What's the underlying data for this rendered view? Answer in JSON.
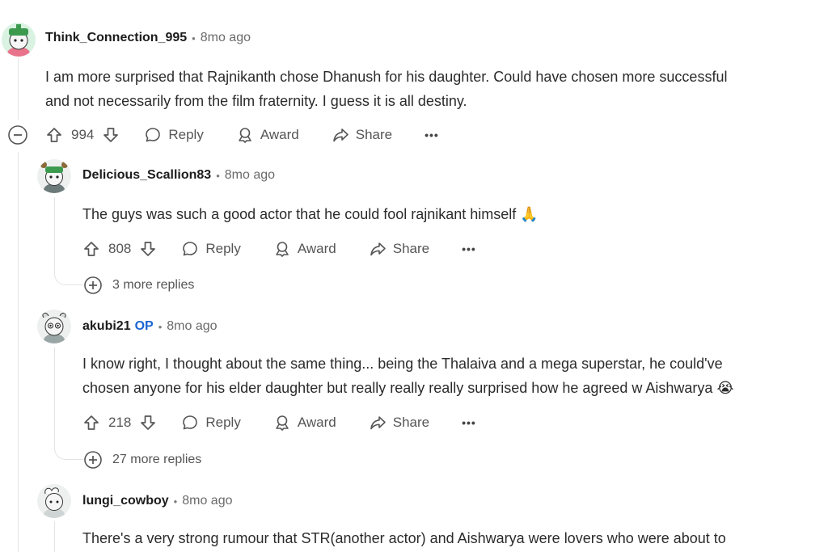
{
  "comments": [
    {
      "username": "Think_Connection_995",
      "time": "8mo ago",
      "lines": [
        "I am more surprised that Rajnikanth chose Dhanush for his daughter. Could have chosen more successful",
        "and not necessarily from the film fraternity. I guess it is all destiny."
      ],
      "votes": "994"
    },
    {
      "username": "Delicious_Scallion83",
      "time": "8mo ago",
      "lines": [
        "The guys was such a good actor that he could fool rajnikant himself"
      ],
      "emoji": "🙏",
      "votes": "808",
      "more_replies": "3 more replies"
    },
    {
      "username": "akubi21",
      "op": "OP",
      "time": "8mo ago",
      "lines": [
        "I know right, I thought about the same thing... being the Thalaiva and a mega superstar, he could've",
        "chosen anyone for his elder daughter but really really really surprised how he agreed w Aishwarya"
      ],
      "emoji": "😭",
      "votes": "218",
      "more_replies": "27 more replies"
    },
    {
      "username": "lungi_cowboy",
      "time": "8mo ago",
      "lines": [
        "There's a very strong rumour that STR(another actor) and Aishwarya were lovers who were about to"
      ]
    }
  ],
  "actions": {
    "reply": "Reply",
    "award": "Award",
    "share": "Share",
    "more": "•••"
  },
  "separator": "•",
  "icons": [
    "upvote-icon",
    "downvote-icon",
    "reply-bubble-icon",
    "award-icon",
    "share-icon",
    "collapse-icon",
    "expand-icon"
  ],
  "colors": {
    "op": "#1a66d2",
    "username": "#1c1c1c",
    "meta": "#6a6a6a",
    "thread_line": "#e0e4e6"
  }
}
